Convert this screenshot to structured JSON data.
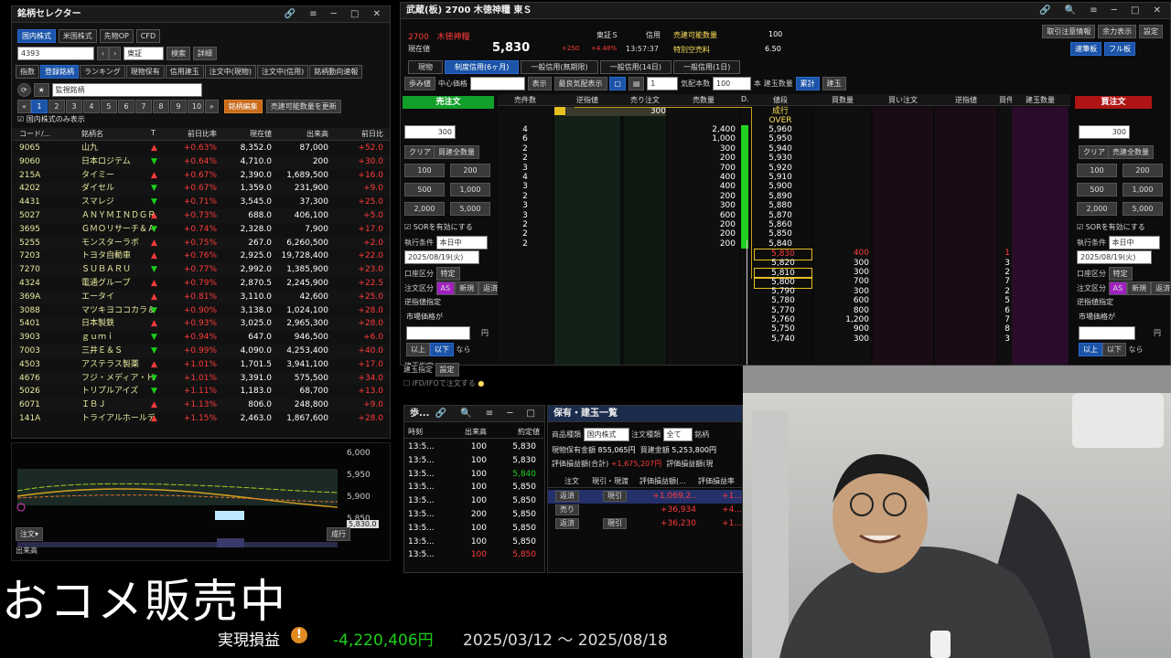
{
  "selector": {
    "title": "銘柄セレクター",
    "tabs": [
      "国内株式",
      "米国株式",
      "先物OP",
      "CFD"
    ],
    "code_input": "4393",
    "market": "東証",
    "search_btn": "検索",
    "detail_btn": "詳細",
    "subtabs": [
      "指数",
      "登録銘柄",
      "ランキング",
      "現物保有",
      "信用建玉",
      "注文中(現物)",
      "注文中(信用)",
      "銘柄動向速報"
    ],
    "list_select": "監視銘柄",
    "pages": [
      "1",
      "2",
      "3",
      "4",
      "5",
      "6",
      "7",
      "8",
      "9",
      "10"
    ],
    "edit_btn": "銘柄編集",
    "update_btn": "売建可能数量を更新",
    "only_domestic": "国内株式のみ表示",
    "headers": [
      "コード/...",
      "銘柄名",
      "T",
      "前日比率",
      "現在値",
      "出来高",
      "前日比"
    ],
    "rows": [
      {
        "code": "9065",
        "name": "山九",
        "t": "up",
        "pct": "+0.63%",
        "price": "8,352.0",
        "vol": "87,000",
        "chg": "+52.0"
      },
      {
        "code": "9060",
        "name": "日本ロジテム",
        "t": "down",
        "pct": "+0.64%",
        "price": "4,710.0",
        "vol": "200",
        "chg": "+30.0"
      },
      {
        "code": "215A",
        "name": "タイミー",
        "t": "up",
        "pct": "+0.67%",
        "price": "2,390.0",
        "vol": "1,689,500",
        "chg": "+16.0"
      },
      {
        "code": "4202",
        "name": "ダイセル",
        "t": "down",
        "pct": "+0.67%",
        "price": "1,359.0",
        "vol": "231,900",
        "chg": "+9.0"
      },
      {
        "code": "4431",
        "name": "スマレジ",
        "t": "down",
        "pct": "+0.71%",
        "price": "3,545.0",
        "vol": "37,300",
        "chg": "+25.0"
      },
      {
        "code": "5027",
        "name": "ＡＮＹＭＩＮＤＧＲ...",
        "t": "up",
        "pct": "+0.73%",
        "price": "688.0",
        "vol": "406,100",
        "chg": "+5.0"
      },
      {
        "code": "3695",
        "name": "ＧＭＯリサーチ＆ＡＩ",
        "t": "down",
        "pct": "+0.74%",
        "price": "2,328.0",
        "vol": "7,900",
        "chg": "+17.0"
      },
      {
        "code": "5255",
        "name": "モンスターラボ",
        "t": "up",
        "pct": "+0.75%",
        "price": "267.0",
        "vol": "6,260,500",
        "chg": "+2.0"
      },
      {
        "code": "7203",
        "name": "トヨタ自動車",
        "t": "up",
        "pct": "+0.76%",
        "price": "2,925.0",
        "vol": "19,728,400",
        "chg": "+22.0"
      },
      {
        "code": "7270",
        "name": "ＳＵＢＡＲＵ",
        "t": "down",
        "pct": "+0.77%",
        "price": "2,992.0",
        "vol": "1,385,900",
        "chg": "+23.0"
      },
      {
        "code": "4324",
        "name": "電通グループ",
        "t": "up",
        "pct": "+0.79%",
        "price": "2,870.5",
        "vol": "2,245,900",
        "chg": "+22.5"
      },
      {
        "code": "369A",
        "name": "エータイ",
        "t": "up",
        "pct": "+0.81%",
        "price": "3,110.0",
        "vol": "42,600",
        "chg": "+25.0"
      },
      {
        "code": "3088",
        "name": "マツキヨココカラ＆カンパ...",
        "t": "down",
        "pct": "+0.90%",
        "price": "3,138.0",
        "vol": "1,024,100",
        "chg": "+28.0"
      },
      {
        "code": "5401",
        "name": "日本製鉄",
        "t": "up",
        "pct": "+0.93%",
        "price": "3,025.0",
        "vol": "2,965,300",
        "chg": "+28.0"
      },
      {
        "code": "3903",
        "name": "ｇｕｍｉ",
        "t": "down",
        "pct": "+0.94%",
        "price": "647.0",
        "vol": "946,500",
        "chg": "+6.0"
      },
      {
        "code": "7003",
        "name": "三井Ｅ＆Ｓ",
        "t": "down",
        "pct": "+0.99%",
        "price": "4,090.0",
        "vol": "4,253,400",
        "chg": "+40.0"
      },
      {
        "code": "4503",
        "name": "アステラス製薬",
        "t": "up",
        "pct": "+1.01%",
        "price": "1,701.5",
        "vol": "3,941,100",
        "chg": "+17.0"
      },
      {
        "code": "4676",
        "name": "フジ・メディア・ＨＤ",
        "t": "down",
        "pct": "+1.01%",
        "price": "3,391.0",
        "vol": "575,500",
        "chg": "+34.0"
      },
      {
        "code": "5026",
        "name": "トリプルアイズ",
        "t": "down",
        "pct": "+1.11%",
        "price": "1,183.0",
        "vol": "68,700",
        "chg": "+13.0"
      },
      {
        "code": "6071",
        "name": "ＩＢＪ",
        "t": "up",
        "pct": "+1.13%",
        "price": "806.0",
        "vol": "248,800",
        "chg": "+9.0"
      },
      {
        "code": "141A",
        "name": "トライアルホールディングス",
        "t": "up",
        "pct": "+1.15%",
        "price": "2,463.0",
        "vol": "1,867,600",
        "chg": "+28.0"
      }
    ]
  },
  "mini_chart": {
    "labels": [
      "6,000",
      "5,950",
      "5,900",
      "5,850"
    ],
    "price_tag": "5,830.0",
    "left_btn": "注文▾",
    "right_btn": "成行",
    "vol_label": "出来高",
    "zero": "0"
  },
  "board": {
    "title": "武蔵(板) 2700 木徳神糧 東Ｓ",
    "code": "2700",
    "name": "木徳神糧",
    "label_now": "現在値",
    "price": "5,830",
    "change": "+250",
    "change_pct": "+4.48%",
    "market": "東証Ｓ",
    "credit": "信用",
    "time": "13:57:37",
    "sell_avail": "売建可能数量",
    "tokubai": "特別空売料",
    "qty_val": "100",
    "tokubai_val": "6.50",
    "top_btns": [
      "取引注意情報",
      "余力表示",
      "設定"
    ],
    "mode_btns": [
      "速筆板",
      "フル板"
    ],
    "tabs": [
      "現物",
      "制度信用(6ヶ月)",
      "一般信用(無期限)",
      "一般信用(14日)",
      "一般信用(1日)"
    ],
    "toolbar": {
      "step": "歩み値",
      "center": "中心価格",
      "show": "表示",
      "best": "最良気配表示",
      "qty_label": "気配本数",
      "qty": "100",
      "unit": "本",
      "tatekyoku": "建玉数量",
      "all": "累計",
      "build": "建玉"
    },
    "sell_btn": "売注文",
    "buy_btn": "買注文",
    "col_headers": [
      "売件数",
      "逆指値",
      "売り注文",
      "売数量",
      "D...",
      "値段",
      "買数量",
      "買い注文",
      "逆指値",
      "買件数",
      "建玉数量"
    ],
    "asks": [
      {
        "cnt": "4",
        "qty": "2,400",
        "price": "5,960"
      },
      {
        "cnt": "6",
        "qty": "1,000",
        "price": "5,950"
      },
      {
        "cnt": "2",
        "qty": "300",
        "price": "5,940"
      },
      {
        "cnt": "2",
        "qty": "200",
        "price": "5,930"
      },
      {
        "cnt": "3",
        "qty": "700",
        "price": "5,920"
      },
      {
        "cnt": "4",
        "qty": "400",
        "price": "5,910"
      },
      {
        "cnt": "3",
        "qty": "400",
        "price": "5,900"
      },
      {
        "cnt": "2",
        "qty": "200",
        "price": "5,890"
      },
      {
        "cnt": "3",
        "qty": "300",
        "price": "5,880"
      },
      {
        "cnt": "3",
        "qty": "600",
        "price": "5,870"
      },
      {
        "cnt": "2",
        "qty": "200",
        "price": "5,860"
      },
      {
        "cnt": "2",
        "qty": "200",
        "price": "5,850"
      },
      {
        "cnt": "2",
        "qty": "200",
        "price": "5,840"
      }
    ],
    "bids": [
      {
        "price": "5,830",
        "qty": "400",
        "cnt": "1"
      },
      {
        "price": "5,820",
        "qty": "300",
        "cnt": "3"
      },
      {
        "price": "5,810",
        "qty": "300",
        "cnt": "2"
      },
      {
        "price": "5,800",
        "qty": "700",
        "cnt": "7"
      },
      {
        "price": "5,790",
        "qty": "300",
        "cnt": "2"
      },
      {
        "price": "5,780",
        "qty": "600",
        "cnt": "5"
      },
      {
        "price": "5,770",
        "qty": "800",
        "cnt": "6"
      },
      {
        "price": "5,760",
        "qty": "1,200",
        "cnt": "7"
      },
      {
        "price": "5,750",
        "qty": "900",
        "cnt": "8"
      },
      {
        "price": "5,740",
        "qty": "300",
        "cnt": "3"
      }
    ],
    "market_row": {
      "order": "300",
      "label1": "成行",
      "label2": "OVER"
    },
    "panel": {
      "qty": "300",
      "clear": "クリア",
      "all_sell": "買建全数量",
      "all_buy": "売建全数量",
      "q": [
        "100",
        "200",
        "500",
        "1,000",
        "2,000",
        "5,000"
      ],
      "sor": "SORを有効にする",
      "cond_label": "執行条件",
      "cond": "本日中",
      "date": "2025/08/19(火)",
      "acct": "口座区分",
      "acct_val": "特定",
      "order_type": "注文区分",
      "as": "AS",
      "new": "新規",
      "close": "返済",
      "rev": "逆指値指定",
      "mkt": "市場価格が",
      "yen": "円",
      "up": "以上",
      "down": "以下",
      "nara": "なら",
      "build_set": "建玉指定",
      "set": "設定",
      "ifd": "IFD/IFOで注文する"
    }
  },
  "ticks": {
    "title": "歩...",
    "headers": [
      "時刻",
      "出来高",
      "約定値"
    ],
    "rows": [
      {
        "t": "13:5...",
        "v": "100",
        "p": "5,830",
        "c": "w"
      },
      {
        "t": "13:5...",
        "v": "100",
        "p": "5,830",
        "c": "w"
      },
      {
        "t": "13:5...",
        "v": "100",
        "p": "5,840",
        "c": "g"
      },
      {
        "t": "13:5...",
        "v": "100",
        "p": "5,850",
        "c": "w"
      },
      {
        "t": "13:5...",
        "v": "100",
        "p": "5,850",
        "c": "w"
      },
      {
        "t": "13:5...",
        "v": "200",
        "p": "5,850",
        "c": "w"
      },
      {
        "t": "13:5...",
        "v": "100",
        "p": "5,850",
        "c": "w"
      },
      {
        "t": "13:5...",
        "v": "100",
        "p": "5,850",
        "c": "w"
      },
      {
        "t": "13:5...",
        "v": "100",
        "p": "5,850",
        "c": "r"
      }
    ]
  },
  "holdings": {
    "title": "保有・建玉一覧",
    "type_label": "商品種類",
    "type": "国内株式",
    "order_type": "注文種類",
    "all": "全て",
    "stock": "銘柄",
    "cash_label": "現物保有金額",
    "cash": "855,065円",
    "credit_label": "買建金額",
    "credit": "5,253,800円",
    "eval_label": "評価損益額(合計)",
    "eval": "+1,675,207円",
    "eval2": "評価損益額(現",
    "cols": [
      "注文",
      "現引・現渡",
      "評価損益額(...",
      "評価損益率"
    ],
    "rows": [
      {
        "a": "返済",
        "b": "現引",
        "v": "+1,069,2..",
        "r": "+1..."
      },
      {
        "a": "売り",
        "b": "",
        "v": "+36,934",
        "r": "+4..."
      },
      {
        "a": "返済",
        "b": "現引",
        "v": "+36,230",
        "r": "+1..."
      }
    ]
  },
  "overlay": {
    "caption": "おコメ販売中",
    "realized_label": "実現損益",
    "realized_value": "-4,220,406円",
    "period": "2025/03/12 ～ 2025/08/18"
  }
}
